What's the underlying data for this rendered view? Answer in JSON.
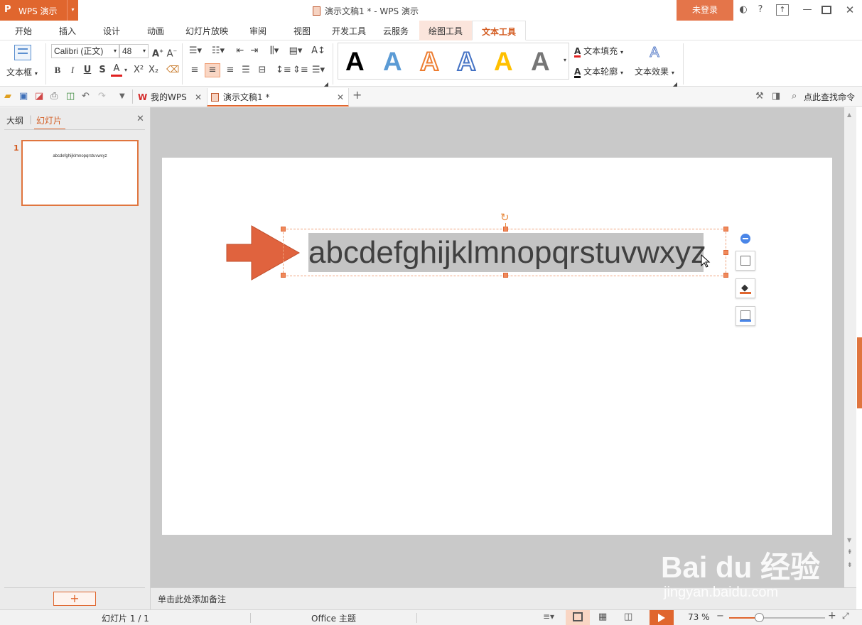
{
  "app": {
    "logo": "P",
    "name": "WPS 演示",
    "dropdown": "▾"
  },
  "window": {
    "title": "演示文稿1 * - WPS 演示",
    "login": "未登录"
  },
  "tabs": [
    "开始",
    "插入",
    "设计",
    "动画",
    "幻灯片放映",
    "审阅",
    "视图",
    "开发工具",
    "云服务",
    "绘图工具",
    "文本工具"
  ],
  "ribbon": {
    "textbox_label": "文本框",
    "font_name": "Calibri (正文)",
    "font_size": "48",
    "text_fill": "文本填充",
    "text_outline": "文本轮廓",
    "text_effect": "文本效果",
    "style_letters": [
      "A",
      "A",
      "A",
      "A",
      "A",
      "A"
    ]
  },
  "doc_tabs": {
    "home": "我的WPS",
    "current": "演示文稿1 *",
    "add": "+"
  },
  "search": {
    "placeholder": "点此查找命令"
  },
  "left_panel": {
    "tab_outline": "大纲",
    "tab_slides": "幻灯片",
    "slide_number": "1",
    "thumb_text": "abcdefghijklmnopqrstuvwxyz",
    "add": "+"
  },
  "slide": {
    "text": "abcdefghijklmnopqrstuvwxyz"
  },
  "notes": {
    "placeholder": "单击此处添加备注"
  },
  "status": {
    "slide_info": "幻灯片 1 / 1",
    "theme": "Office 主题",
    "zoom": "73 %",
    "zoom_fraction": 0.31
  },
  "watermark": {
    "logo": "Bai du 经验",
    "url": "jingyan.baidu.com"
  },
  "colors": {
    "accent": "#e0662e",
    "active_tab": "#d35b20",
    "arrow": "#e0633e"
  }
}
